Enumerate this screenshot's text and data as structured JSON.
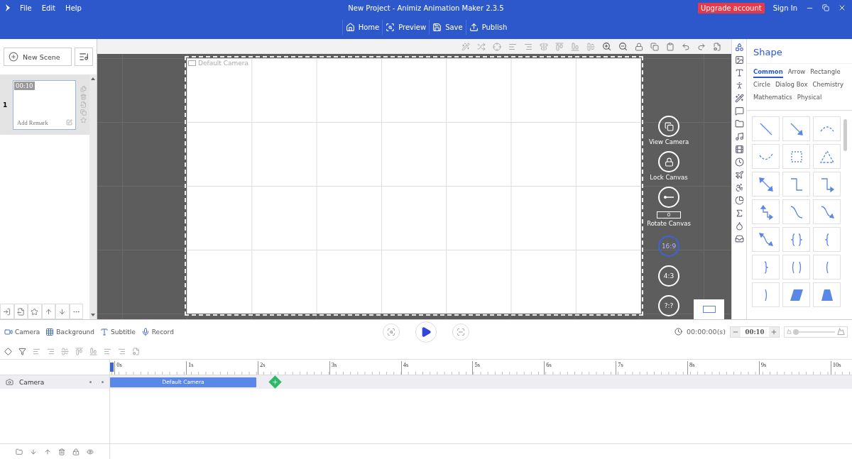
{
  "menu": [
    {
      "label": "File"
    },
    {
      "label": "Edit"
    },
    {
      "label": "Help"
    }
  ],
  "window": {
    "title": "New Project - Animiz Animation Maker 2.3.5"
  },
  "account": {
    "upgrade": "Upgrade account",
    "sign_in": "Sign In"
  },
  "toolbar": [
    {
      "kind": "home",
      "label": "Home"
    },
    {
      "kind": "preview",
      "label": "Preview"
    },
    {
      "kind": "save",
      "label": "Save"
    },
    {
      "kind": "publish",
      "label": "Publish"
    }
  ],
  "scenes": {
    "new_scene": "New Scene",
    "items": [
      {
        "number": "1",
        "duration": "00:10",
        "remark": "Add Remark",
        "selected": true
      }
    ]
  },
  "canvas": {
    "camera_label": "Default Camera",
    "controls": [
      {
        "kind": "view",
        "label": "View Camera"
      },
      {
        "kind": "lock",
        "label": "Lock Canvas"
      },
      {
        "kind": "rotate",
        "label": "Rotate Canvas",
        "value": "0"
      },
      {
        "kind": "ratio",
        "ratio": "16:9",
        "selected": true
      },
      {
        "kind": "ratio",
        "ratio": "4:3",
        "selected": false
      },
      {
        "kind": "ratio",
        "ratio": "?:?",
        "selected": false
      }
    ]
  },
  "shape_panel": {
    "title": "Shape",
    "categories": [
      {
        "label": "Common",
        "selected": true
      },
      {
        "label": "Arrow",
        "selected": false
      },
      {
        "label": "Rectangle",
        "selected": false
      },
      {
        "label": "Circle",
        "selected": false
      },
      {
        "label": "Dialog Box",
        "selected": false
      },
      {
        "label": "Chemistry",
        "selected": false
      },
      {
        "label": "Mathematics",
        "selected": false
      },
      {
        "label": "Physical",
        "selected": false
      }
    ]
  },
  "tracks_bar": [
    {
      "kind": "camera",
      "label": "Camera"
    },
    {
      "kind": "background",
      "label": "Background"
    },
    {
      "kind": "subtitle",
      "label": "Subtitle"
    },
    {
      "kind": "record",
      "label": "Record"
    }
  ],
  "playback": {
    "time": "00:00:00(s)",
    "duration": "00:10",
    "zoom": {
      "level": 0.05
    }
  },
  "timeline": {
    "ticks": [
      "0s",
      "1s",
      "2s",
      "3s",
      "4s",
      "5s",
      "6s",
      "7s",
      "8s",
      "9s",
      "10s"
    ],
    "tracks": [
      {
        "name": "Camera",
        "clips": [
          {
            "label": "Default Camera"
          }
        ]
      }
    ]
  }
}
